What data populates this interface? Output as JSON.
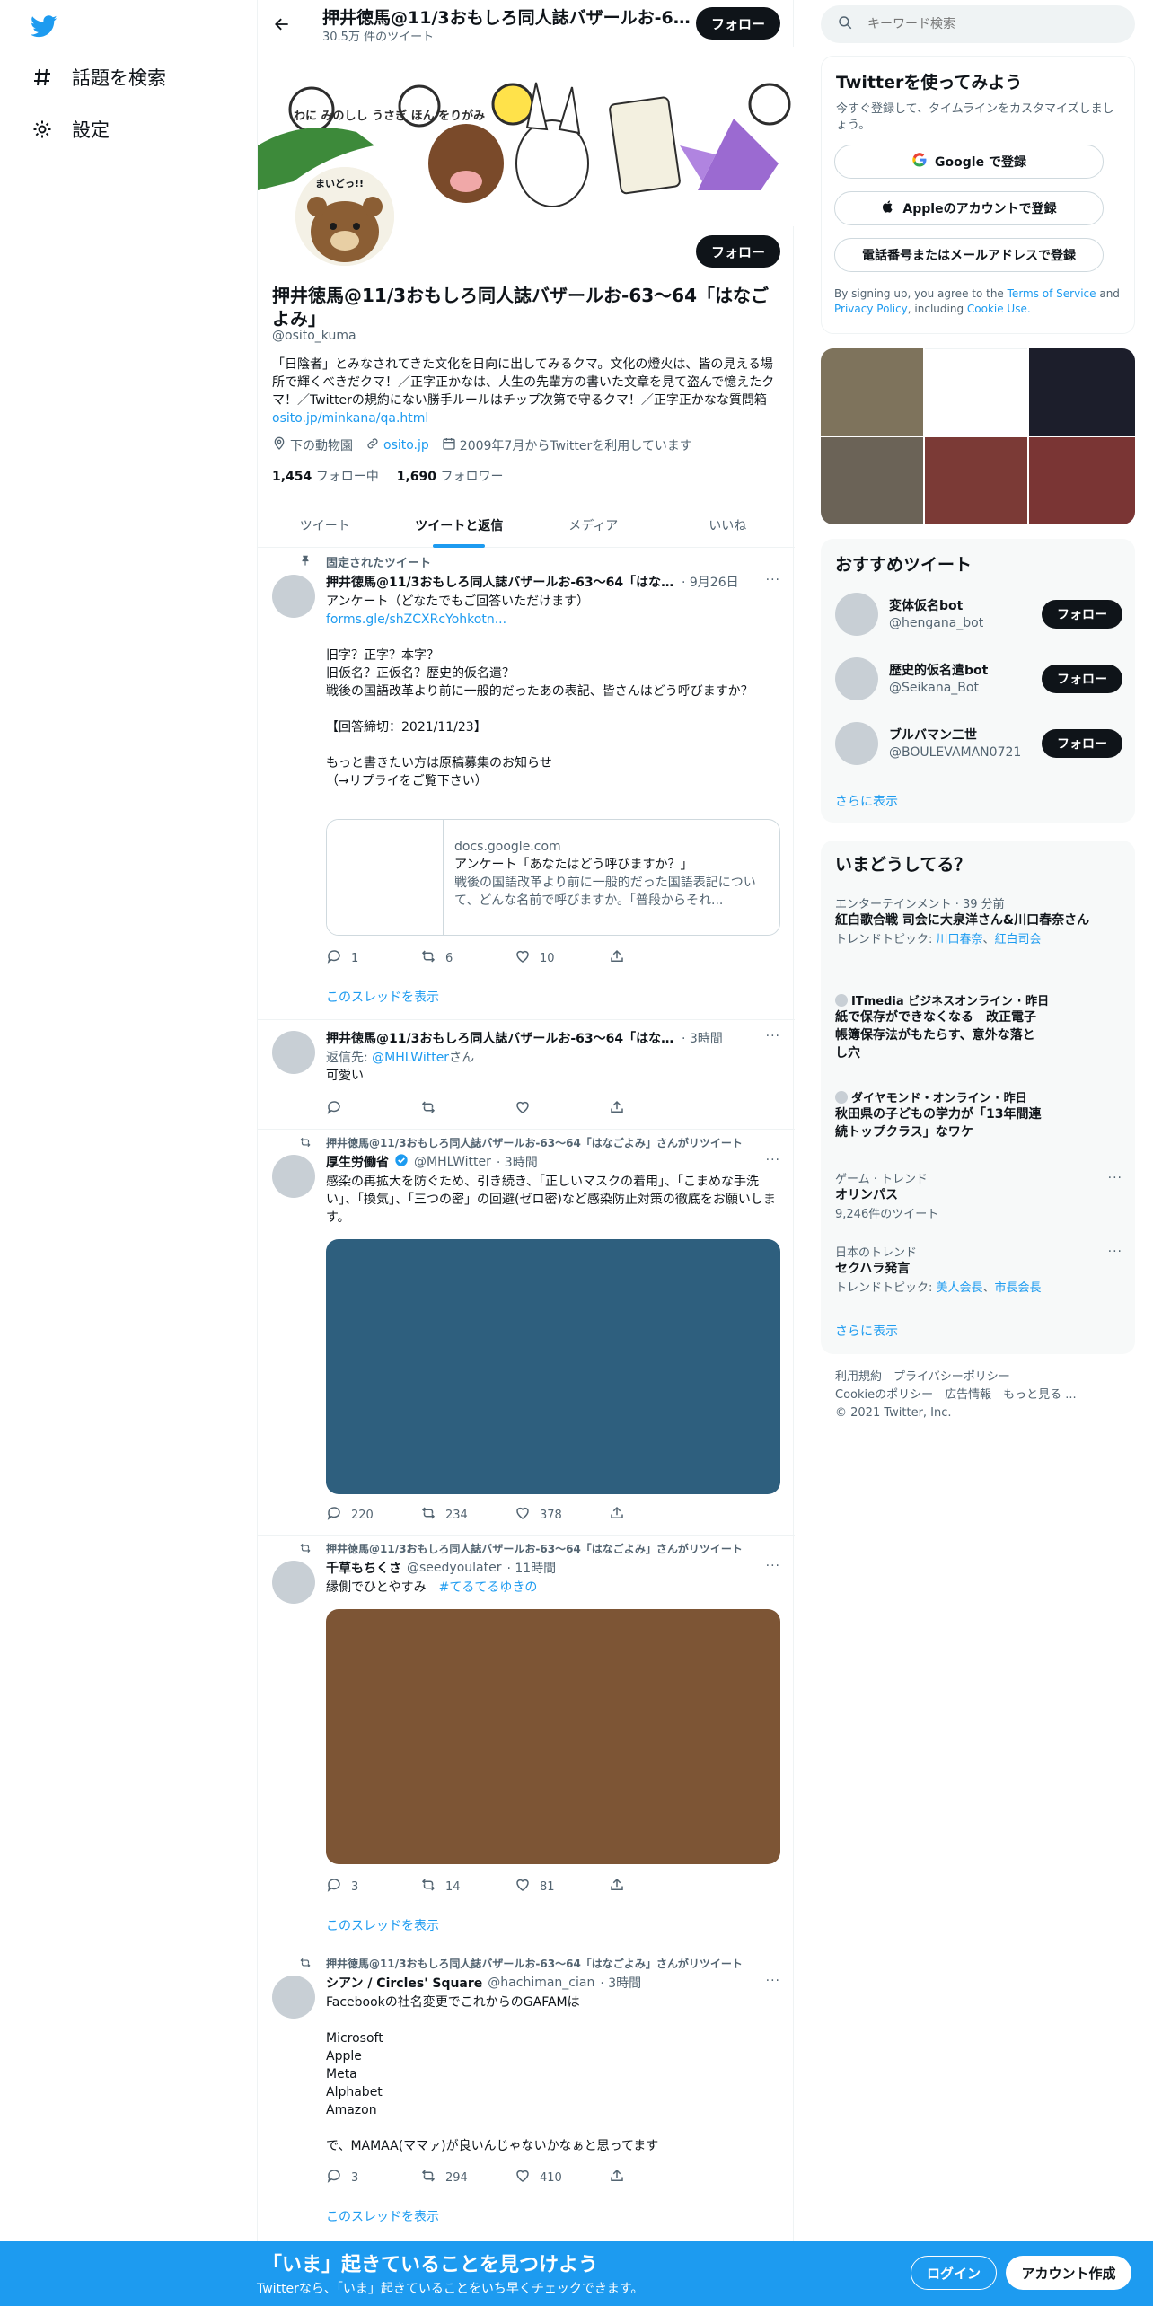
{
  "nav": {
    "explore": "話題を検索",
    "settings": "設定"
  },
  "header": {
    "name": "押井徳馬@11/3おもしろ同人誌バザールお-63～64「はなごよみ」",
    "count": "30.5万 件のツイート",
    "follow": "フォロー"
  },
  "banner": {
    "title_chars": "わに みのしし うさぎ ほん をりがみ",
    "sticker": "まいどっ!!"
  },
  "profile": {
    "name": "押井徳馬@11/3おもしろ同人誌バザールお-63～64「はなごよみ」",
    "handle": "@osito_kuma",
    "follow_button": "フォロー",
    "bio": "「日陰者」とみなされてきた文化を日向に出してみるクマ。文化の燈火は、皆の見える場所で輝くべきだクマ！／正字正かなは、人生の先輩方の書いた文章を見て盗んで憶えたクマ！／Twitterの規約にない勝手ルールはチップ次第で守るクマ！／正字正かなな質問箱 ",
    "bio_link": "osito.jp/minkana/qa.html",
    "location": "下の動物園",
    "website": "osito.jp",
    "joined": "2009年7月からTwitterを利用しています",
    "following_count": "1,454",
    "following_label": "フォロー中",
    "followers_count": "1,690",
    "followers_label": "フォロワー"
  },
  "tabs": [
    "ツイート",
    "ツイートと返信",
    "メディア",
    "いいね"
  ],
  "tweets": [
    {
      "context": "固定されたツイート",
      "name": "押井徳馬@11/3おもしろ同人誌バザールお-63～64「はなごよみ」",
      "time": "· 9月26日",
      "text": "アンケート（どなたでもご回答いただけます）",
      "link": "forms.gle/shZCXRcYohkotn...",
      "text2": "旧字？正字？本字？\n旧仮名？正仮名？歴史的仮名遣？\n戦後の国語改革より前に一般的だったあの表記、皆さんはどう呼びますか？\n\n【回答締切：2021/11/23】\n\nもっと書きたい方は原稿募集のお知らせ\n（→リプライをご覧下さい）",
      "card": {
        "domain": "docs.google.com",
        "title": "アンケート「あなたはどう呼びますか？」",
        "desc": "戦後の国語改革より前に一般的だった国語表記について、どんな名前で呼びますか。「普段からそれ..."
      },
      "replies": "1",
      "retweets": "6",
      "likes": "10",
      "thread": "このスレッドを表示"
    },
    {
      "name": "押井徳馬@11/3おもしろ同人誌バザールお-63～64「はなごよみ」",
      "time": "· 3時間",
      "reply_to_label": "返信先: ",
      "reply_to": "@MHLWitter",
      "reply_suffix": "さん",
      "text": "可愛い"
    },
    {
      "context": "押井徳馬@11/3おもしろ同人誌バザールお-63～64「はなごよみ」さんがリツイート",
      "name": "厚生労働省",
      "handle": "@MHLWitter",
      "time": "· 3時間",
      "text": "感染の再拡大を防ぐため、引き続き、「正しいマスクの着用」、「こまめな手洗い」、「換気」、「三つの密」の回避(ゼロ密)など感染防止対策の徹底をお願いします。",
      "media_color": "#2e5f7e",
      "replies": "220",
      "retweets": "234",
      "likes": "378"
    },
    {
      "context": "押井徳馬@11/3おもしろ同人誌バザールお-63～64「はなごよみ」さんがリツイート",
      "name": "千草もちくさ",
      "handle": "@seedyoulater",
      "time": "· 11時間",
      "text": "縁側でひとやすみ　",
      "hashtag": "#てるてるゆきの",
      "media_color": "#7d5535",
      "replies": "3",
      "retweets": "14",
      "likes": "81",
      "thread": "このスレッドを表示"
    },
    {
      "context": "押井徳馬@11/3おもしろ同人誌バザールお-63～64「はなごよみ」さんがリツイート",
      "name": "シアン / Circles' Square",
      "handle": "@hachiman_cian",
      "time": "· 3時間",
      "text": "Facebookの社名変更でこれからのGAFAMは\n\nMicrosoft\nApple\nMeta\nAlphabet\nAmazon\n\nで、MAMAA(ママァ)が良いんじゃないかなぁと思ってます",
      "replies": "3",
      "retweets": "294",
      "likes": "410",
      "thread": "このスレッドを表示"
    }
  ],
  "right": {
    "search_placeholder": "キーワード検索",
    "signup": {
      "title": "Twitterを使ってみよう",
      "desc": "今すぐ登録して、タイムラインをカスタマイズしましょう。",
      "google": "Google で登録",
      "apple": "Appleのアカウントで登録",
      "phone": "電話番号またはメールアドレスで登録",
      "terms_pre": "By signing up, you agree to the ",
      "terms": "Terms of Service",
      "and": " and ",
      "privacy": "Privacy Policy",
      "including": ", including ",
      "cookie": "Cookie Use."
    },
    "photo_colors": [
      "#7e735c",
      "#ffffff",
      "#1c1e2b",
      "#6b6357",
      "#7b3a36",
      "#7a3534"
    ],
    "suggest": {
      "title": "おすすめツイート",
      "users": [
        {
          "name": "変体仮名bot",
          "handle": "@hengana_bot"
        },
        {
          "name": "歴史的仮名遣bot",
          "handle": "@Seikana_Bot"
        },
        {
          "name": "ブルバマン二世",
          "handle": "@BOULEVAMAN0721"
        }
      ],
      "follow": "フォロー",
      "more": "さらに表示"
    },
    "trends": {
      "title": "いまどうしてる？",
      "items": [
        {
          "cat": "エンターテインメント · 39 分前",
          "title": "紅白歌合戦 司会に大泉洋さん&川口春奈さん",
          "sub_label": "トレンドトピック: ",
          "sub1": "川口春奈",
          "sub_sep": "、",
          "sub2": "紅白司会"
        },
        {
          "cat": "ITmedia ビジネスオンライン · 昨日",
          "title": "紙で保存ができなくなる　改正電子帳簿保存法がもたらす、意外な落とし穴"
        },
        {
          "cat": "ダイヤモンド・オンライン · 昨日",
          "title": "秋田県の子どもの学力が「13年間連続トップクラス」なワケ"
        },
        {
          "cat": "ゲーム · トレンド",
          "title": "オリンパス",
          "count": "9,246件のツイート"
        },
        {
          "cat": "日本のトレンド",
          "title": "セクハラ発言",
          "sub_label": "トレンドトピック: ",
          "sub1": "美人会長",
          "sub_sep": "、",
          "sub2": "市長会長"
        }
      ],
      "more": "さらに表示"
    },
    "footer": {
      "l1": "利用規約　プライバシーポリシー",
      "l2": "Cookieのポリシー　広告情報　もっと見る ...",
      "l3": "© 2021 Twitter, Inc."
    }
  },
  "bottom": {
    "title": "「いま」起きていることを見つけよう",
    "sub": "Twitterなら、「いま」起きていることをいち早くチェックできます。",
    "login": "ログイン",
    "signup": "アカウント作成"
  },
  "colors": {
    "accent": "#1d9bf0",
    "text": "#0f1419",
    "muted": "#536471"
  }
}
